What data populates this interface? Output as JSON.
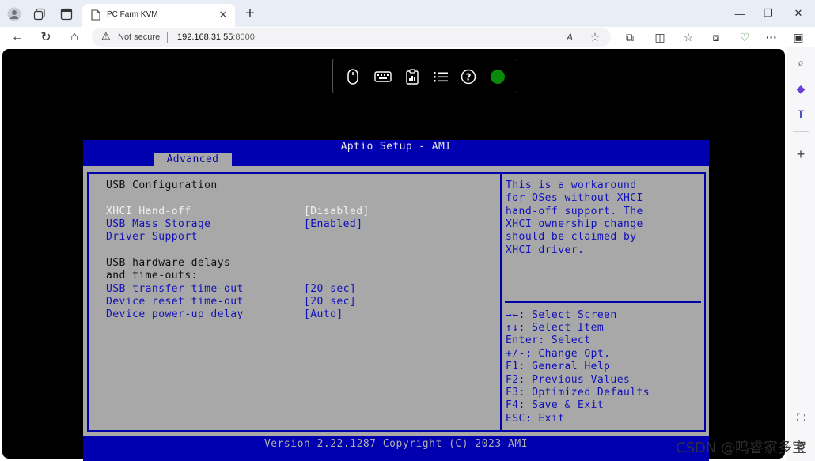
{
  "browser": {
    "tab": {
      "title": "PC Farm KVM",
      "close": "✕"
    },
    "new_tab": "+",
    "window": {
      "minimize": "—",
      "restore": "❐",
      "close": "✕"
    },
    "nav": {
      "back": "←",
      "refresh": "↻",
      "home": "⌂"
    },
    "address": {
      "warning_icon": "⚠",
      "security_label": "Not secure",
      "host": "192.168.31.55",
      "port": ":8000"
    },
    "address_icons": {
      "read_aloud": "A",
      "favorite": "☆"
    },
    "toolbar_icons": {
      "extensions": "⧉",
      "split": "◫",
      "favorites": "☆",
      "collections": "⧈",
      "performance": "♡",
      "more": "···",
      "sidebar_toggle": "▣"
    }
  },
  "kvm_toolbar": {
    "mouse": "🖱",
    "keyboard": "⌨",
    "clipboard": "📋",
    "menu": "☰",
    "help": "?",
    "status_color": "#0a8a0a"
  },
  "bios": {
    "title": "Aptio Setup - AMI",
    "active_tab": "Advanced",
    "section_title": "USB Configuration",
    "items": [
      {
        "label": "XHCI Hand-off",
        "value": "[Disabled]"
      },
      {
        "label": "USB Mass Storage",
        "value": "[Enabled]"
      },
      {
        "label": "Driver Support",
        "value": ""
      }
    ],
    "delays_heading": [
      "USB hardware delays",
      "and time-outs:"
    ],
    "timeouts": [
      {
        "label": "USB transfer time-out",
        "value": "[20 sec]"
      },
      {
        "label": "Device reset time-out",
        "value": "[20 sec]"
      },
      {
        "label": "Device power-up delay",
        "value": "[Auto]"
      }
    ],
    "help_lines": [
      "This is a workaround",
      "for OSes without XHCI",
      "hand-off support. The",
      "XHCI ownership change",
      "should be claimed by",
      "XHCI driver."
    ],
    "key_lines": [
      "→←: Select Screen",
      "↑↓: Select Item",
      "Enter: Select",
      "+/-: Change Opt.",
      "F1: General Help",
      "F2: Previous Values",
      "F3: Optimized Defaults",
      "F4: Save & Exit",
      "ESC: Exit"
    ],
    "version": "Version 2.22.1287 Copyright (C) 2023 AMI"
  },
  "sidebar": {
    "search": "⌕",
    "copilot": "◆",
    "teams": "T",
    "add": "+",
    "screenshot": "⛶",
    "settings": "⚙"
  },
  "watermark": "CSDN @鸣睿家多宝"
}
